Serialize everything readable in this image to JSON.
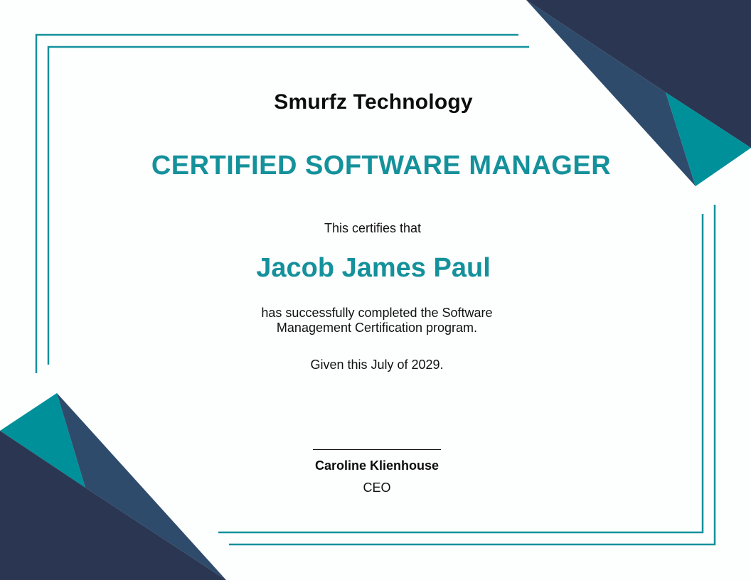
{
  "certificate": {
    "company": "Smurfz Technology",
    "title": "CERTIFIED SOFTWARE MANAGER",
    "intro": "This certifies that",
    "recipient": "Jacob James Paul",
    "description_line1": "has successfully completed the Software",
    "description_line2": "Management Certification program.",
    "given": "Given this July of 2029.",
    "signer_name": "Caroline Klienhouse",
    "signer_role": "CEO"
  },
  "colors": {
    "accent": "#14919b",
    "navy": "#2b3752",
    "slate": "#2f4b6c",
    "teal": "#00909a",
    "text": "#111111"
  }
}
